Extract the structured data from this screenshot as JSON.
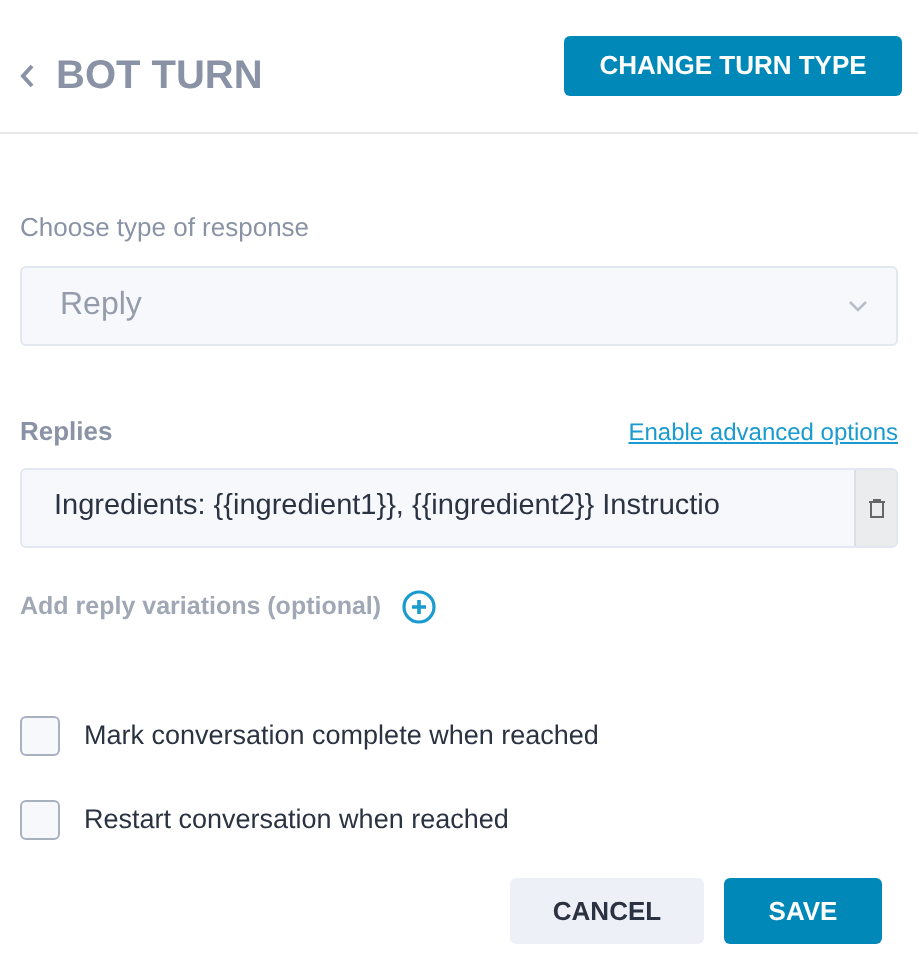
{
  "header": {
    "title": "BOT TURN",
    "action": "CHANGE TURN TYPE"
  },
  "response_type": {
    "label": "Choose type of response",
    "value": "Reply",
    "disabled": true
  },
  "replies": {
    "label": "Replies",
    "link": "Enable advanced options",
    "items": [
      {
        "value": "Ingredients: {{ingredient1}}, {{ingredient2}} Instructio"
      }
    ],
    "add_label": "Add reply variations (optional)"
  },
  "options": [
    {
      "label": "Mark conversation complete when reached",
      "checked": false
    },
    {
      "label": "Restart conversation when reached",
      "checked": false
    }
  ],
  "buttons": [
    {
      "label": "CANCEL",
      "kind": "secondary"
    },
    {
      "label": "SAVE",
      "kind": "primary"
    }
  ]
}
